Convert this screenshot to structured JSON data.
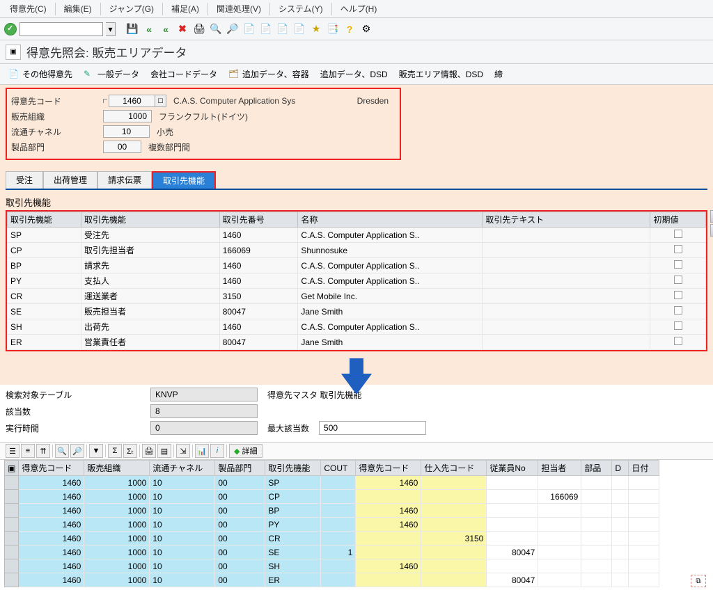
{
  "menu": {
    "items": [
      "得意先(C)",
      "編集(E)",
      "ジャンプ(G)",
      "補足(A)",
      "関連処理(V)",
      "システム(Y)",
      "ヘルプ(H)"
    ]
  },
  "title": "得意先照会: 販売エリアデータ",
  "actions": {
    "a0": "その他得意先",
    "a1": "一般データ",
    "a2": "会社コードデータ",
    "a3": "追加データ、容器",
    "a4": "追加データ、DSD",
    "a5": "販売エリア情報、DSD",
    "a6": "締"
  },
  "header": {
    "l_customer": "得意先コード",
    "customer": "1460",
    "customer_name": "C.A.S. Computer Application Sys",
    "city": "Dresden",
    "l_salesorg": "販売組織",
    "salesorg": "1000",
    "salesorg_desc": "フランクフルト(ドイツ)",
    "l_distch": "流通チャネル",
    "distch": "10",
    "distch_desc": "小売",
    "l_div": "製品部門",
    "div": "00",
    "div_desc": "複数部門間"
  },
  "tabs": {
    "t0": "受注",
    "t1": "出荷管理",
    "t2": "請求伝票",
    "t3": "取引先機能"
  },
  "partner_section_title": "取引先機能",
  "ptable": {
    "h0": "取引先機能",
    "h1": "取引先機能",
    "h2": "取引先番号",
    "h3": "名称",
    "h4": "取引先テキスト",
    "h5": "初期値",
    "rows": [
      {
        "c0": "SP",
        "c1": "受注先",
        "c2": "1460",
        "c3": "C.A.S. Computer Application S..",
        "c4": ""
      },
      {
        "c0": "CP",
        "c1": "取引先担当者",
        "c2": "166069",
        "c3": "Shunnosuke",
        "c4": ""
      },
      {
        "c0": "BP",
        "c1": "請求先",
        "c2": "1460",
        "c3": "C.A.S. Computer Application S..",
        "c4": ""
      },
      {
        "c0": "PY",
        "c1": "支払人",
        "c2": "1460",
        "c3": "C.A.S. Computer Application S..",
        "c4": ""
      },
      {
        "c0": "CR",
        "c1": "運送業者",
        "c2": "3150",
        "c3": "Get Mobile Inc.",
        "c4": ""
      },
      {
        "c0": "SE",
        "c1": "販売担当者",
        "c2": "80047",
        "c3": "Jane Smith",
        "c4": ""
      },
      {
        "c0": "SH",
        "c1": "出荷先",
        "c2": "1460",
        "c3": "C.A.S. Computer Application S..",
        "c4": ""
      },
      {
        "c0": "ER",
        "c1": "営業責任者",
        "c2": "80047",
        "c3": "Jane Smith",
        "c4": ""
      }
    ]
  },
  "search": {
    "l_table": "検索対象テーブル",
    "table": "KNVP",
    "table_desc": "得意先マスタ 取引先機能",
    "l_hits": "該当数",
    "hits": "8",
    "l_runtime": "実行時間",
    "runtime": "0",
    "l_maxhits": "最大該当数",
    "maxhits": "500"
  },
  "btoolbar": {
    "detail": "詳細"
  },
  "rtable": {
    "h": [
      "得意先コード",
      "販売組織",
      "流通チャネル",
      "製品部門",
      "取引先機能",
      "COUT",
      "得意先コード",
      "仕入先コード",
      "従業員No",
      "担当者",
      "部品",
      "D",
      "日付"
    ],
    "rows": [
      {
        "c0": "1460",
        "c1": "1000",
        "c2": "10",
        "c3": "00",
        "c4": "SP",
        "c5": "",
        "c6": "1460",
        "c7": "",
        "c8": "",
        "c9": ""
      },
      {
        "c0": "1460",
        "c1": "1000",
        "c2": "10",
        "c3": "00",
        "c4": "CP",
        "c5": "",
        "c6": "",
        "c7": "",
        "c8": "",
        "c9": "166069"
      },
      {
        "c0": "1460",
        "c1": "1000",
        "c2": "10",
        "c3": "00",
        "c4": "BP",
        "c5": "",
        "c6": "1460",
        "c7": "",
        "c8": "",
        "c9": ""
      },
      {
        "c0": "1460",
        "c1": "1000",
        "c2": "10",
        "c3": "00",
        "c4": "PY",
        "c5": "",
        "c6": "1460",
        "c7": "",
        "c8": "",
        "c9": ""
      },
      {
        "c0": "1460",
        "c1": "1000",
        "c2": "10",
        "c3": "00",
        "c4": "CR",
        "c5": "",
        "c6": "",
        "c7": "3150",
        "c8": "",
        "c9": ""
      },
      {
        "c0": "1460",
        "c1": "1000",
        "c2": "10",
        "c3": "00",
        "c4": "SE",
        "c5": "1",
        "c6": "",
        "c7": "",
        "c8": "80047",
        "c9": ""
      },
      {
        "c0": "1460",
        "c1": "1000",
        "c2": "10",
        "c3": "00",
        "c4": "SH",
        "c5": "",
        "c6": "1460",
        "c7": "",
        "c8": "",
        "c9": ""
      },
      {
        "c0": "1460",
        "c1": "1000",
        "c2": "10",
        "c3": "00",
        "c4": "ER",
        "c5": "",
        "c6": "",
        "c7": "",
        "c8": "80047",
        "c9": ""
      }
    ]
  }
}
